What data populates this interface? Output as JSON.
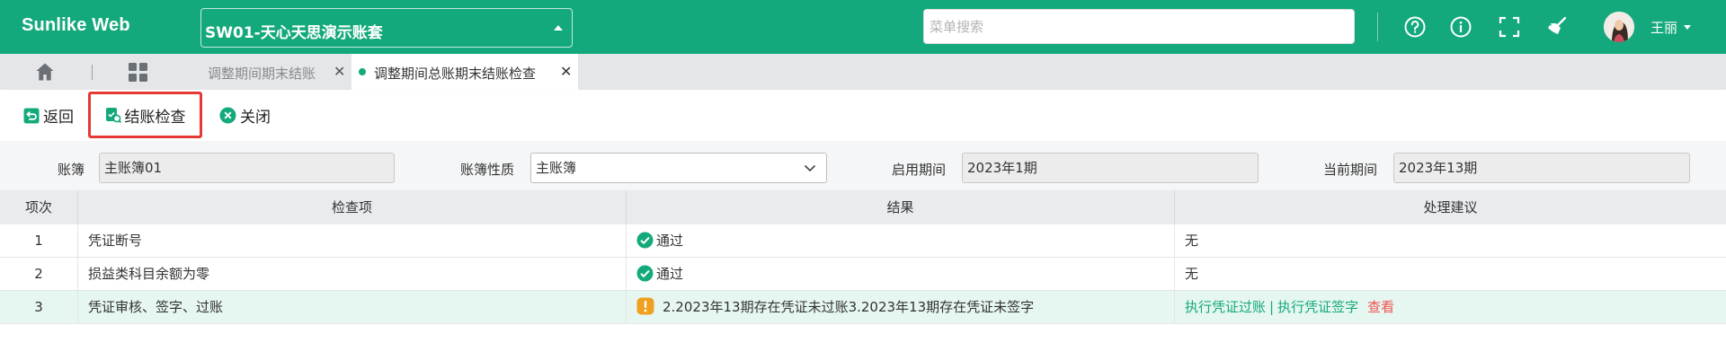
{
  "header": {
    "logo": "Sunlike Web",
    "account_set": "SW01-天心天思演示账套",
    "menu_search_placeholder": "菜单搜索",
    "icons": [
      "help-circle-icon",
      "info-circle-icon",
      "fullscreen-icon",
      "clear-cache-broom-icon"
    ],
    "user_name": "王丽"
  },
  "tabs": {
    "items": [
      {
        "label": "调整期间期末结账",
        "active": false
      },
      {
        "label": "调整期间总账期末结账检查",
        "active": true
      }
    ]
  },
  "toolbar": {
    "back_label": "返回",
    "check_label": "结账检查",
    "close_label": "关闭"
  },
  "filters": {
    "ledger_label": "账簿",
    "ledger_value": "主账簿01",
    "ledger_type_label": "账簿性质",
    "ledger_type_value": "主账簿",
    "start_period_label": "启用期间",
    "start_period_value": "2023年1期",
    "current_period_label": "当前期间",
    "current_period_value": "2023年13期"
  },
  "table": {
    "columns": [
      "项次",
      "检查项",
      "结果",
      "处理建议"
    ],
    "rows": [
      {
        "index": "1",
        "item": "凭证断号",
        "result": "通过",
        "result_status": "pass",
        "suggestion": "无"
      },
      {
        "index": "2",
        "item": "损益类科目余额为零",
        "result": "通过",
        "result_status": "pass",
        "suggestion": "无"
      },
      {
        "index": "3",
        "item": "凭证审核、签字、过账",
        "result": "2.2023年13期存在凭证未过账3.2023年13期存在凭证未签字",
        "result_status": "warning",
        "actions": {
          "post": "执行凭证过账",
          "separator": "|",
          "sign": "执行凭证签字",
          "view": "查看"
        }
      }
    ]
  },
  "colors": {
    "brand": "#14a97c",
    "pass": "#14a97c",
    "warning": "#f0a020",
    "danger_link": "#ef5350",
    "highlight_row": "#e6f6f0"
  }
}
